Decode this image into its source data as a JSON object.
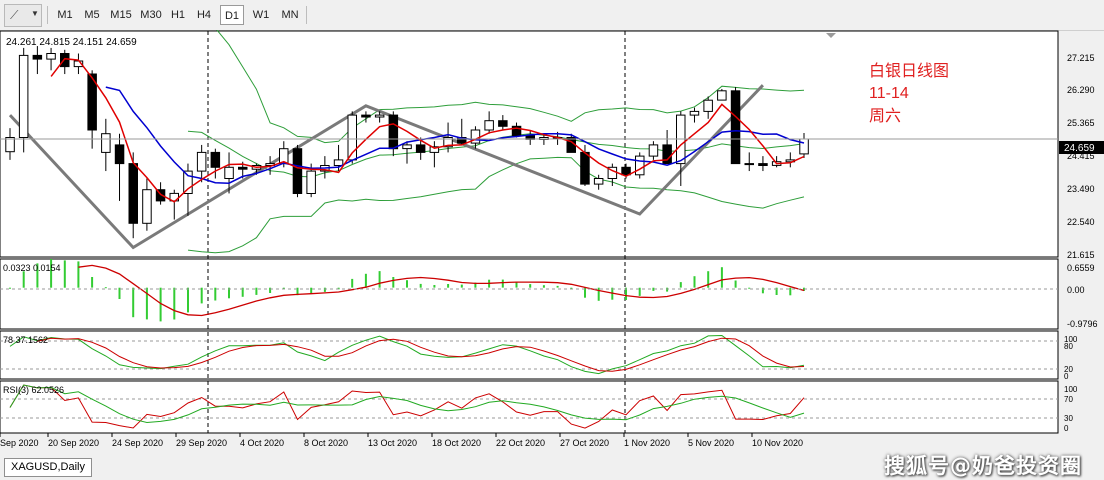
{
  "toolbar": {
    "tool_icon": "line-tool-icon",
    "timeframes": [
      "M1",
      "M5",
      "M15",
      "M30",
      "H1",
      "H4",
      "D1",
      "W1",
      "MN"
    ],
    "active_timeframe": "D1"
  },
  "main_chart": {
    "ohlc_info": "24.261 24.815 24.151 24.659",
    "current_price": "24.659",
    "price_ticks": [
      "27.215",
      "26.290",
      "25.365",
      "24.415",
      "23.490",
      "22.540",
      "21.615"
    ],
    "annotation": [
      "白银日线图",
      "11-14",
      "周六"
    ]
  },
  "macd": {
    "values_text": "0.0323 0.0154",
    "ticks": [
      "0.6559",
      "0.00",
      "-0.9796"
    ]
  },
  "stochastic": {
    "values_text": "78 37.1562",
    "ticks": [
      "100",
      "80",
      "20",
      "0"
    ]
  },
  "rsi": {
    "values_text": "RSI(3) 62.0526",
    "ticks": [
      "100",
      "70",
      "30",
      "0"
    ]
  },
  "time_labels": [
    "Sep 2020",
    "20 Sep 2020",
    "24 Sep 2020",
    "29 Sep 2020",
    "4 Oct 2020",
    "8 Oct 2020",
    "13 Oct 2020",
    "18 Oct 2020",
    "22 Oct 2020",
    "27 Oct 2020",
    "1 Nov 2020",
    "5 Nov 2020",
    "10 Nov 2020"
  ],
  "symbol_tab": "XAGUSD,Daily",
  "watermark": "搜狐号@奶爸投资圈",
  "colors": {
    "bull": "#ffffff",
    "bear": "#000000",
    "ma_fast": "#e00000",
    "ma_slow": "#0000d0",
    "bands": "#2e9e3a",
    "macd_hist": "#33cc33",
    "signal": "#cc0000",
    "zigzag": "#7a7a7a",
    "annotation": "#e02020"
  },
  "chart_data": {
    "type": "candlestick",
    "symbol": "XAGUSD",
    "timeframe": "Daily",
    "candles": [
      [
        24.32,
        24.95,
        24.1,
        24.7
      ],
      [
        24.7,
        27.1,
        24.3,
        26.9
      ],
      [
        26.9,
        27.15,
        26.4,
        26.8
      ],
      [
        26.8,
        27.1,
        26.5,
        26.95
      ],
      [
        26.95,
        27.05,
        26.4,
        26.6
      ],
      [
        26.6,
        26.95,
        26.4,
        26.75
      ],
      [
        26.4,
        26.5,
        24.4,
        24.9
      ],
      [
        24.3,
        25.2,
        23.8,
        24.8
      ],
      [
        24.5,
        24.8,
        23.0,
        24.0
      ],
      [
        24.0,
        24.3,
        22.0,
        22.4
      ],
      [
        22.4,
        23.6,
        22.2,
        23.3
      ],
      [
        23.3,
        23.5,
        22.9,
        23.0
      ],
      [
        23.0,
        23.3,
        22.5,
        23.2
      ],
      [
        23.2,
        24.0,
        22.6,
        23.8
      ],
      [
        23.8,
        24.5,
        23.5,
        24.3
      ],
      [
        24.3,
        24.4,
        23.6,
        23.9
      ],
      [
        23.6,
        24.3,
        23.2,
        23.9
      ],
      [
        23.9,
        24.05,
        23.6,
        23.85
      ],
      [
        23.85,
        24.0,
        23.7,
        23.95
      ],
      [
        23.95,
        24.2,
        23.7,
        24.0
      ],
      [
        24.0,
        24.6,
        23.9,
        24.4
      ],
      [
        24.4,
        24.5,
        23.1,
        23.2
      ],
      [
        23.2,
        24.0,
        23.1,
        23.8
      ],
      [
        23.8,
        24.2,
        23.6,
        23.95
      ],
      [
        23.95,
        24.5,
        23.8,
        24.1
      ],
      [
        24.1,
        25.4,
        24.0,
        25.3
      ],
      [
        25.3,
        25.4,
        25.1,
        25.25
      ],
      [
        25.25,
        25.4,
        25.1,
        25.3
      ],
      [
        25.3,
        25.4,
        24.2,
        24.4
      ],
      [
        24.4,
        24.6,
        24.0,
        24.5
      ],
      [
        24.5,
        24.7,
        24.1,
        24.3
      ],
      [
        24.3,
        24.6,
        23.9,
        24.45
      ],
      [
        24.45,
        25.1,
        24.3,
        24.7
      ],
      [
        24.7,
        25.2,
        24.5,
        24.55
      ],
      [
        24.55,
        25.0,
        24.4,
        24.9
      ],
      [
        24.9,
        25.4,
        24.8,
        25.15
      ],
      [
        25.15,
        25.3,
        24.9,
        25.0
      ],
      [
        25.0,
        25.1,
        24.7,
        24.75
      ],
      [
        24.75,
        24.9,
        24.5,
        24.65
      ],
      [
        24.65,
        24.8,
        24.5,
        24.7
      ],
      [
        24.7,
        24.85,
        24.5,
        24.7
      ],
      [
        24.7,
        24.8,
        24.3,
        24.3
      ],
      [
        24.3,
        24.5,
        23.4,
        23.45
      ],
      [
        23.45,
        23.7,
        23.3,
        23.6
      ],
      [
        23.6,
        24.0,
        23.4,
        23.9
      ],
      [
        23.9,
        24.0,
        23.6,
        23.7
      ],
      [
        23.7,
        24.3,
        23.6,
        24.2
      ],
      [
        24.2,
        24.6,
        24.1,
        24.5
      ],
      [
        24.5,
        24.9,
        24.3,
        24.0
      ],
      [
        24.0,
        25.4,
        23.4,
        25.3
      ],
      [
        25.3,
        25.5,
        25.1,
        25.4
      ],
      [
        25.4,
        25.8,
        25.2,
        25.7
      ],
      [
        25.7,
        26.0,
        25.8,
        25.95
      ],
      [
        25.95,
        26.05,
        24.1,
        24.0
      ],
      [
        24.0,
        24.3,
        23.8,
        24.0
      ],
      [
        24.0,
        24.2,
        23.8,
        23.95
      ],
      [
        23.95,
        24.2,
        23.9,
        24.05
      ],
      [
        24.05,
        24.3,
        23.9,
        24.1
      ],
      [
        24.26,
        24.82,
        24.15,
        24.66
      ]
    ],
    "price_range": [
      21.55,
      27.5
    ],
    "indicators": [
      "MA fast",
      "MA slow",
      "Bollinger Bands",
      "MACD",
      "Stochastic",
      "RSI(3)"
    ],
    "macd_range": [
      -0.9796,
      0.6559
    ],
    "stochastic_levels": [
      20,
      80
    ],
    "rsi_levels": [
      30,
      70
    ]
  }
}
